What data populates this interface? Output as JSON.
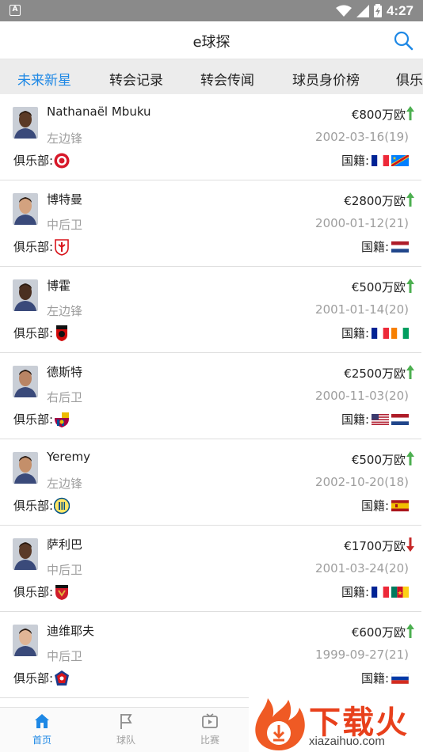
{
  "status": {
    "time": "4:27"
  },
  "app": {
    "title": "e球探"
  },
  "tabs": [
    "未来新星",
    "转会记录",
    "转会传闻",
    "球员身价榜",
    "俱乐"
  ],
  "labels": {
    "club": "俱乐部:",
    "nationality": "国籍:"
  },
  "players": [
    {
      "name": "Nathanaël Mbuku",
      "position": "左边锋",
      "value": "€800万欧",
      "trend": "up",
      "birth": "2002-03-16(19)",
      "club": "reims-badge",
      "flags": [
        "france",
        "dr-congo"
      ],
      "skin": "#5b3a26"
    },
    {
      "name": "博特曼",
      "position": "中后卫",
      "value": "€2800万欧",
      "trend": "up",
      "birth": "2000-01-12(21)",
      "club": "lille-badge",
      "flags": [
        "netherlands"
      ],
      "skin": "#d3a27f"
    },
    {
      "name": "博霍",
      "position": "左边锋",
      "value": "€500万欧",
      "trend": "up",
      "birth": "2001-01-14(20)",
      "club": "rennes-badge",
      "flags": [
        "france",
        "ivory-coast"
      ],
      "skin": "#4a2f20"
    },
    {
      "name": "德斯特",
      "position": "右后卫",
      "value": "€2500万欧",
      "trend": "up",
      "birth": "2000-11-03(20)",
      "club": "barcelona-badge",
      "flags": [
        "usa",
        "netherlands"
      ],
      "skin": "#b98464"
    },
    {
      "name": "Yeremy",
      "position": "左边锋",
      "value": "€500万欧",
      "trend": "up",
      "birth": "2002-10-20(18)",
      "club": "villarreal-badge",
      "flags": [
        "spain"
      ],
      "skin": "#c48f6a"
    },
    {
      "name": "萨利巴",
      "position": "中后卫",
      "value": "€1700万欧",
      "trend": "down",
      "birth": "2001-03-24(20)",
      "club": "nice-badge",
      "flags": [
        "france",
        "cameroon"
      ],
      "skin": "#5a3a28"
    },
    {
      "name": "迪维耶夫",
      "position": "中后卫",
      "value": "€600万欧",
      "trend": "up",
      "birth": "1999-09-27(21)",
      "club": "cska-badge",
      "flags": [
        "russia"
      ],
      "skin": "#e0b596"
    }
  ],
  "bottom_nav": [
    {
      "label": "首页",
      "icon": "home-icon",
      "active": true
    },
    {
      "label": "球队",
      "icon": "flag-icon",
      "active": false
    },
    {
      "label": "比赛",
      "icon": "tv-icon",
      "active": false
    }
  ],
  "watermark": {
    "big": "下载火",
    "small": "xiazaihuo.com"
  },
  "colors": {
    "accent": "#1e88e5",
    "up": "#4caf50",
    "down": "#c62828",
    "statusbar": "#8a8a8a",
    "tabbar": "#ececec"
  }
}
